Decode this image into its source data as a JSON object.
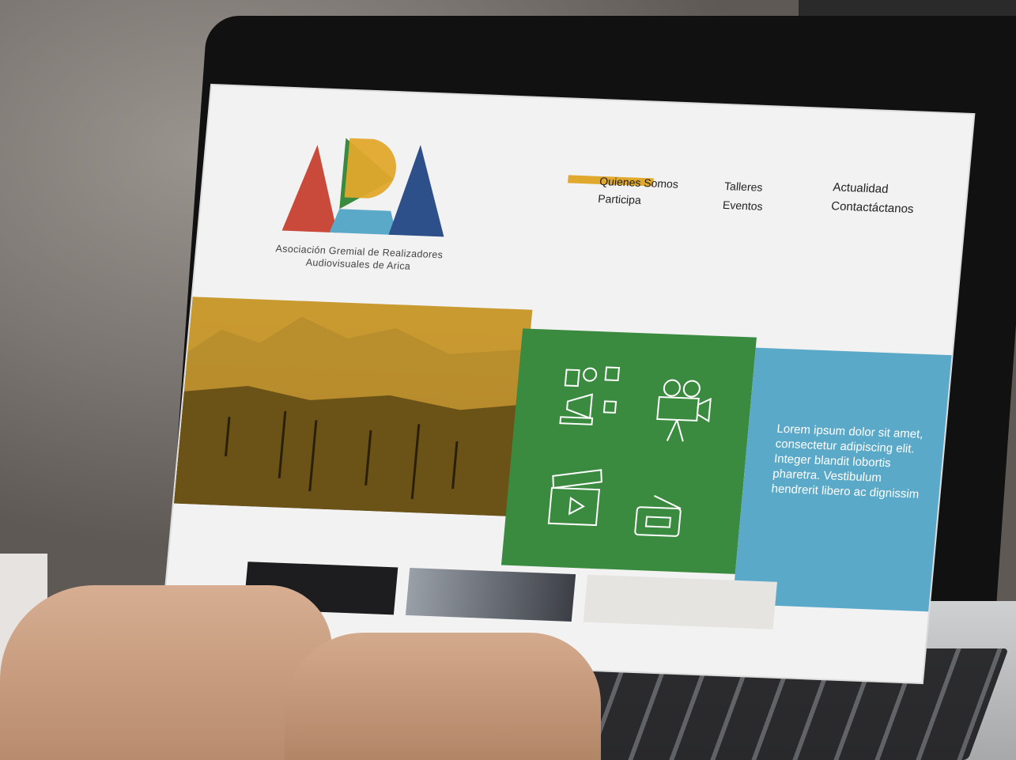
{
  "site": {
    "logo_alt": "ARA",
    "tagline_line1": "Asociación Gremial de Realizadores",
    "tagline_line2": "Audiovisuales de Arica"
  },
  "nav": {
    "items": [
      {
        "label": "Quienes Somos"
      },
      {
        "label": "Participa"
      },
      {
        "label": "Talleres"
      },
      {
        "label": "Eventos"
      },
      {
        "label": "Actualidad"
      },
      {
        "label": "Contactáctanos"
      }
    ]
  },
  "hero": {
    "text": "Lorem ipsum dolor sit amet, consectetur adipiscing elit. Integer blandit lobortis pharetra. Vestibulum hendrerit libero ac dignissim"
  },
  "icons": [
    "social-media-megaphone-icon",
    "film-camera-icon",
    "clapperboard-icon",
    "ticket-icon"
  ],
  "colors": {
    "accent_yellow": "#e0a82c",
    "green": "#3a8a3f",
    "blue": "#5aa9c8",
    "logo_red": "#c94a3a",
    "logo_navy": "#2d4f8a"
  }
}
